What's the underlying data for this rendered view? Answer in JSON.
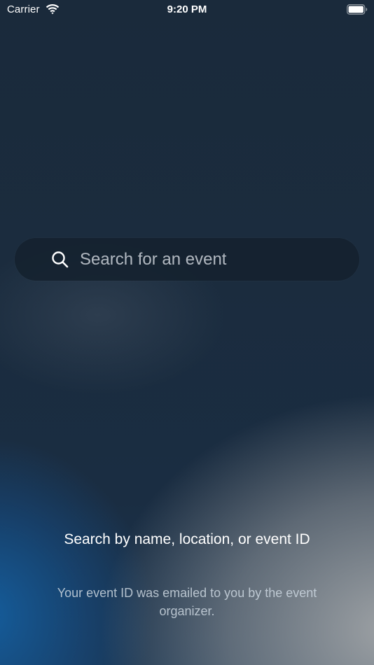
{
  "status_bar": {
    "carrier": "Carrier",
    "time": "9:20 PM",
    "wifi_icon": "wifi-icon",
    "battery_icon": "battery-icon"
  },
  "search": {
    "placeholder": "Search for an event",
    "value": "",
    "icon": "search-icon"
  },
  "help": {
    "title": "Search by name, location, or event ID",
    "subtitle": "Your event ID was emailed to you by the event organizer."
  },
  "colors": {
    "text_primary": "#ffffff",
    "text_secondary": "#cdd7e1",
    "background_top": "#1a2a3b",
    "accent_blue": "#145fa0",
    "accent_gray": "#a5a8aa"
  }
}
